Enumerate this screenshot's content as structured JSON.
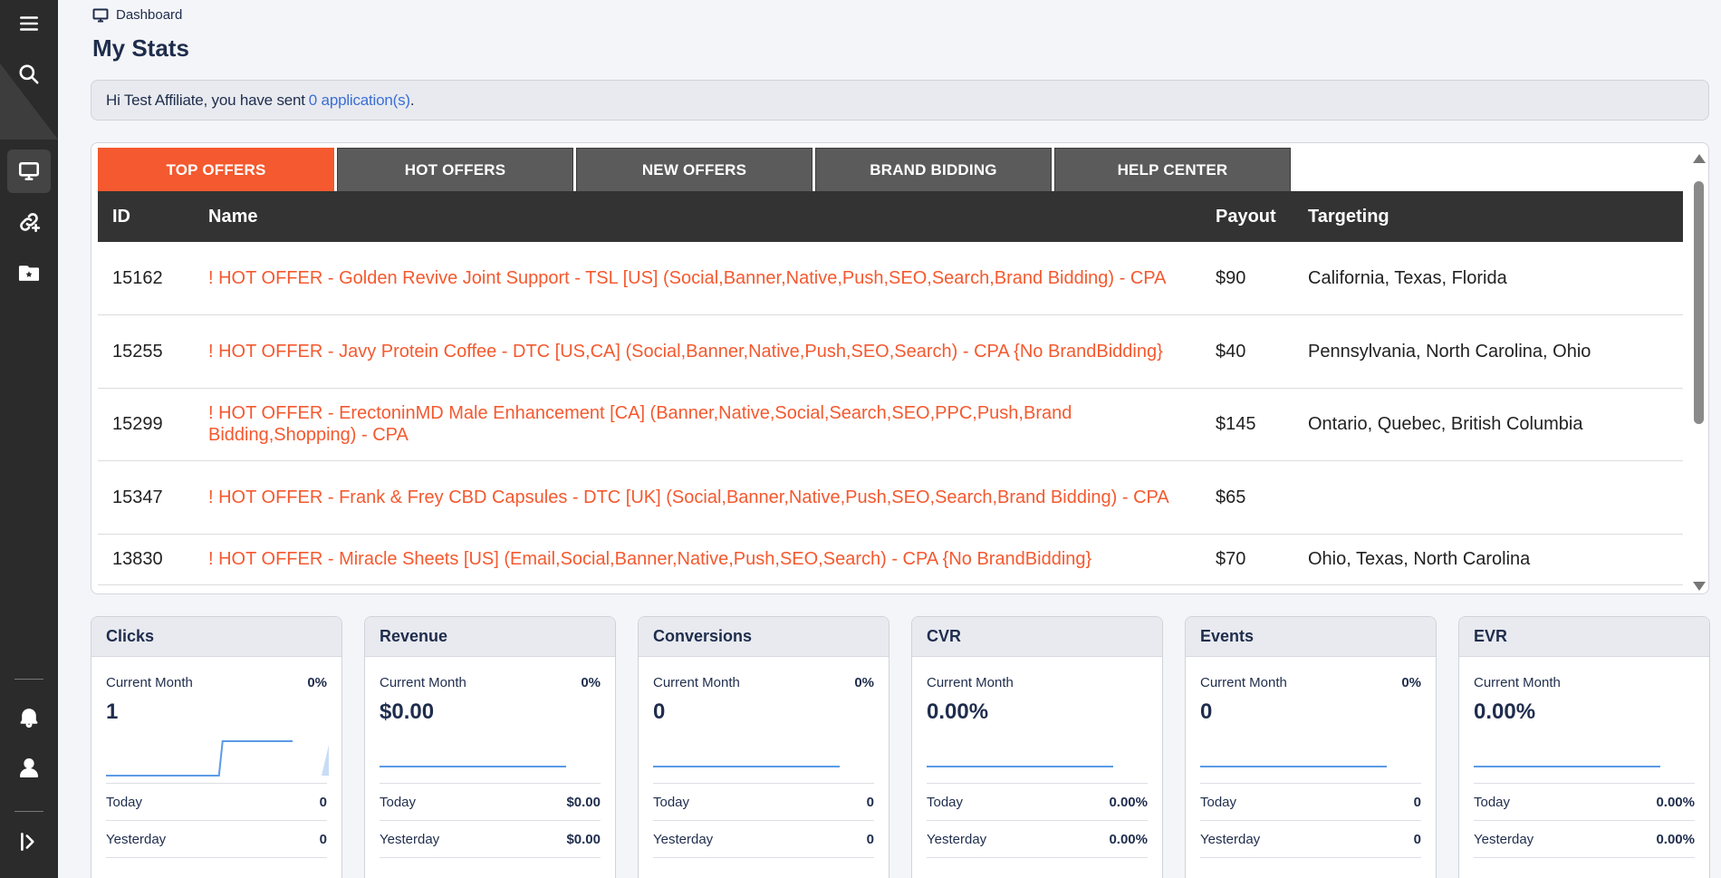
{
  "breadcrumb": {
    "label": "Dashboard"
  },
  "page_title": "My Stats",
  "alert": {
    "prefix": "Hi Test Affiliate, you have sent",
    "link": "0 application(s)",
    "suffix": "."
  },
  "tabs": [
    {
      "label": "TOP OFFERS",
      "active": true
    },
    {
      "label": "HOT OFFERS",
      "active": false
    },
    {
      "label": "NEW OFFERS",
      "active": false
    },
    {
      "label": "BRAND BIDDING",
      "active": false
    },
    {
      "label": "HELP CENTER",
      "active": false
    }
  ],
  "table": {
    "headers": {
      "id": "ID",
      "name": "Name",
      "payout": "Payout",
      "targeting": "Targeting"
    },
    "rows": [
      {
        "id": "15162",
        "name": "! HOT OFFER - Golden Revive Joint Support - TSL [US] (Social,Banner,Native,Push,SEO,Search,Brand Bidding) - CPA",
        "payout": "$90",
        "targeting": "California, Texas, Florida"
      },
      {
        "id": "15255",
        "name": "! HOT OFFER - Javy Protein Coffee - DTC [US,CA] (Social,Banner,Native,Push,SEO,Search) - CPA {No BrandBidding}",
        "payout": "$40",
        "targeting": "Pennsylvania, North Carolina, Ohio"
      },
      {
        "id": "15299",
        "name": "! HOT OFFER - ErectoninMD Male Enhancement [CA] (Banner,Native,Social,Search,SEO,PPC,Push,Brand Bidding,Shopping) - CPA",
        "payout": "$145",
        "targeting": "Ontario, Quebec, British Columbia"
      },
      {
        "id": "15347",
        "name": "! HOT OFFER - Frank & Frey CBD Capsules - DTC [UK] (Social,Banner,Native,Push,SEO,Search,Brand Bidding) - CPA",
        "payout": "$65",
        "targeting": ""
      },
      {
        "id": "13830",
        "name": "! HOT OFFER - Miracle Sheets [US] (Email,Social,Banner,Native,Push,SEO,Search) - CPA {No BrandBidding}",
        "payout": "$70",
        "targeting": "Ohio, Texas, North Carolina"
      }
    ]
  },
  "cards": [
    {
      "title": "Clicks",
      "period": "Current Month",
      "pct": "0%",
      "value": "1",
      "today_label": "Today",
      "today": "0",
      "yesterday_label": "Yesterday",
      "yesterday": "0",
      "trend": [
        0,
        0,
        0,
        0,
        0,
        1,
        1,
        1,
        1
      ]
    },
    {
      "title": "Revenue",
      "period": "Current Month",
      "pct": "0%",
      "value": "$0.00",
      "today_label": "Today",
      "today": "$0.00",
      "yesterday_label": "Yesterday",
      "yesterday": "$0.00",
      "trend": [
        0,
        0,
        0,
        0,
        0,
        0,
        0,
        0,
        0
      ]
    },
    {
      "title": "Conversions",
      "period": "Current Month",
      "pct": "0%",
      "value": "0",
      "today_label": "Today",
      "today": "0",
      "yesterday_label": "Yesterday",
      "yesterday": "0",
      "trend": [
        0,
        0,
        0,
        0,
        0,
        0,
        0,
        0,
        0
      ]
    },
    {
      "title": "CVR",
      "period": "Current Month",
      "pct": "",
      "value": "0.00%",
      "today_label": "Today",
      "today": "0.00%",
      "yesterday_label": "Yesterday",
      "yesterday": "0.00%",
      "trend": [
        0,
        0,
        0,
        0,
        0,
        0,
        0,
        0,
        0
      ]
    },
    {
      "title": "Events",
      "period": "Current Month",
      "pct": "0%",
      "value": "0",
      "today_label": "Today",
      "today": "0",
      "yesterday_label": "Yesterday",
      "yesterday": "0",
      "trend": [
        0,
        0,
        0,
        0,
        0,
        0,
        0,
        0,
        0
      ]
    },
    {
      "title": "EVR",
      "period": "Current Month",
      "pct": "",
      "value": "0.00%",
      "today_label": "Today",
      "today": "0.00%",
      "yesterday_label": "Yesterday",
      "yesterday": "0.00%",
      "trend": [
        0,
        0,
        0,
        0,
        0,
        0,
        0,
        0,
        0
      ]
    }
  ],
  "colors": {
    "accent": "#f4592f",
    "sidebar": "#2b2b2b",
    "link": "#3b6fd4",
    "spark": "#5b9be6",
    "navy": "#1f2d4d"
  },
  "sidebar_icons": [
    "menu-icon",
    "search-icon",
    "monitor-icon",
    "link-add-icon",
    "star-folder-icon",
    "bell-icon",
    "user-icon",
    "collapse-icon"
  ]
}
